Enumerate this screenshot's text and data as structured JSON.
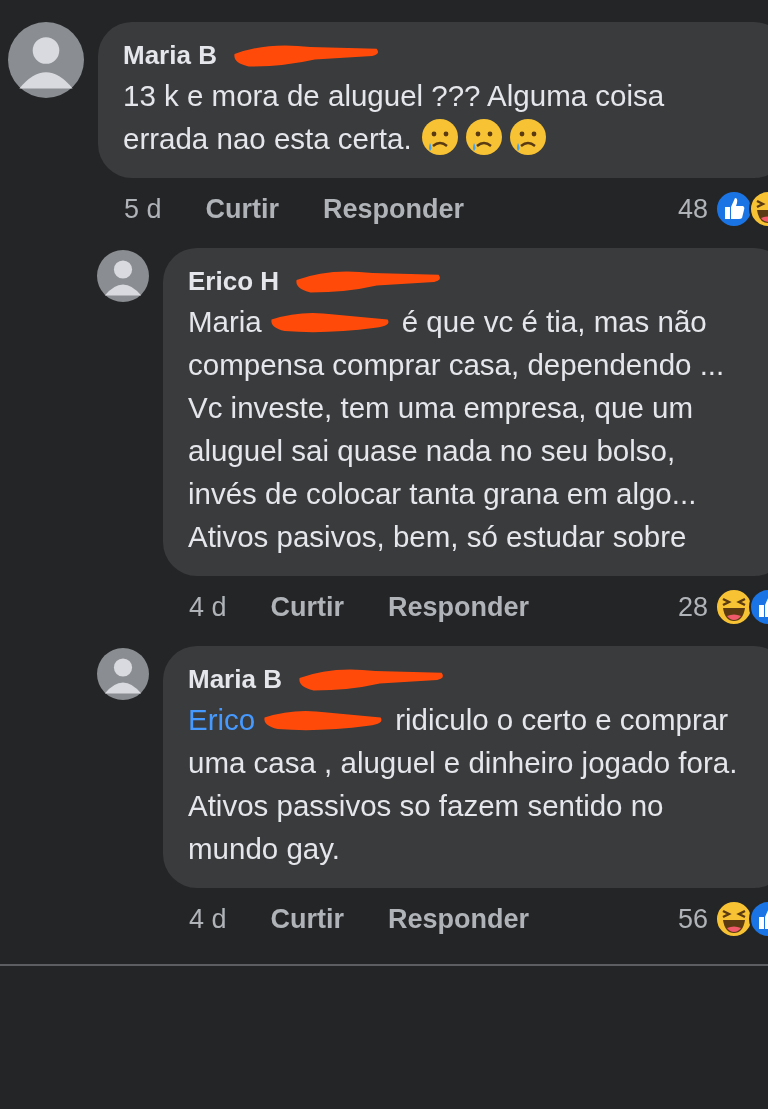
{
  "comments": [
    {
      "name": "Maria B",
      "body": [
        {
          "kind": "text",
          "text": "13 k e mora de aluguel ??? Alguma coisa errada nao esta certa. "
        }
      ],
      "emojis": [
        {
          "kind": "sad"
        },
        {
          "kind": "sad"
        },
        {
          "kind": "sad"
        }
      ],
      "time": "5 d",
      "like_label": "Curtir",
      "reply_label": "Responder",
      "reaction_count": "48",
      "reactions": [
        {
          "kind": "like"
        },
        {
          "kind": "haha"
        }
      ],
      "children": [
        {
          "name": "Erico H",
          "body": [
            {
              "kind": "text",
              "text": "Maria"
            },
            {
              "kind": "redaction"
            },
            {
              "kind": "text",
              "text": "é que vc é tia, mas não compensa comprar casa, dependendo ...\nVc investe, tem uma empresa, que um aluguel sai quase nada no seu bolso, invés de colocar tanta grana em algo... Ativos pasivos, bem, só estudar sobre"
            }
          ],
          "time": "4 d",
          "like_label": "Curtir",
          "reply_label": "Responder",
          "reaction_count": "28",
          "reactions": [
            {
              "kind": "haha"
            },
            {
              "kind": "like"
            }
          ]
        },
        {
          "name": "Maria B",
          "body": [
            {
              "kind": "mention",
              "text": "Erico"
            },
            {
              "kind": "redaction"
            },
            {
              "kind": "text",
              "text": "ridiculo o certo e comprar uma casa , aluguel e dinheiro jogado fora. Ativos passivos so fazem sentido no mundo gay."
            }
          ],
          "time": "4 d",
          "like_label": "Curtir",
          "reply_label": "Responder",
          "reaction_count": "56",
          "reactions": [
            {
              "kind": "haha"
            },
            {
              "kind": "like"
            }
          ]
        }
      ]
    }
  ]
}
